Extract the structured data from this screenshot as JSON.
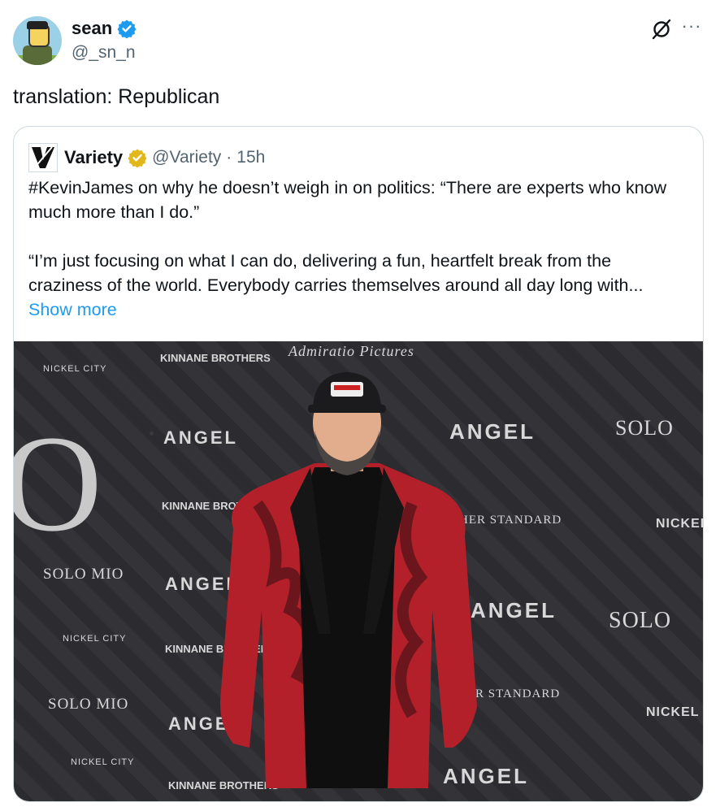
{
  "author": {
    "display_name": "sean",
    "handle": "@_sn_n",
    "verified": true
  },
  "actions": {
    "grok_icon": "grok-icon",
    "more_label": "···"
  },
  "tweet": {
    "text": "translation: Republican"
  },
  "quoted": {
    "name": "Variety",
    "handle": "@Variety",
    "separator": "·",
    "time": "15h",
    "paragraph1": "#KevinJames on why he doesn’t weigh in on politics: “There are experts who know much more than I do.”",
    "paragraph2": "“I’m just focusing on what I can do, delivering a fun, heartfelt break from the craziness of the world. Everybody carries themselves around all day long with...",
    "show_more": "Show more"
  },
  "photo_backdrop": {
    "angel": "ANGEL",
    "kinnane": "KINNANE BROTHERS",
    "solo_mio": "SOLO MIO",
    "solo": "SOLO",
    "nickel_city": "NICKEL CITY",
    "nickel": "NICKEL",
    "higher_standard": "HER STANDARD",
    "admiratio": "Admiratio Pictures",
    "big_o": "O"
  },
  "colors": {
    "link": "#1d9bf0",
    "verified_blue": "#1d9bf0",
    "verified_gold": "#e2b719",
    "secondary_text": "#536471",
    "jacket_red": "#b3202a"
  }
}
